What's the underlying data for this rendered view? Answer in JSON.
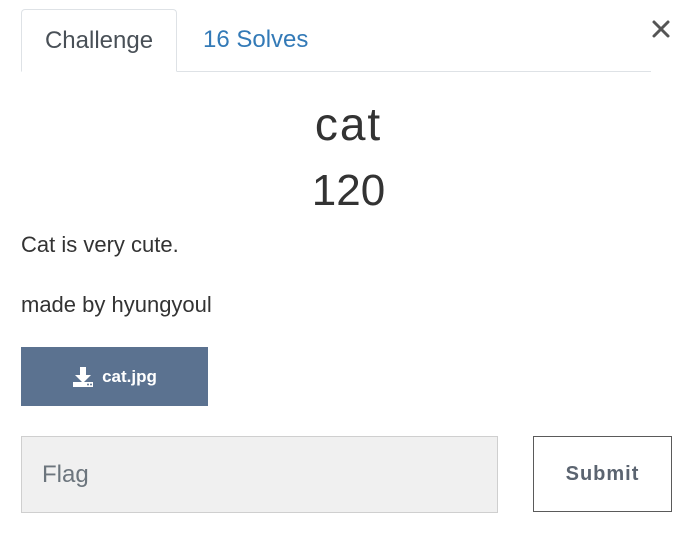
{
  "tabs": {
    "challenge_label": "Challenge",
    "solves_label": "16 Solves"
  },
  "challenge": {
    "name": "cat",
    "value": "120",
    "description": "Cat is very cute.",
    "author_line": "made by hyungyoul"
  },
  "files": [
    {
      "label": "cat.jpg",
      "icon": "download-icon"
    }
  ],
  "flag_form": {
    "placeholder": "Flag",
    "value": "",
    "submit_label": "Submit"
  },
  "colors": {
    "tab_link": "#337ab7",
    "file_button": "#5b7290",
    "input_background": "#f0f0f0"
  },
  "icons": {
    "close": "close-icon",
    "download": "download-icon"
  }
}
